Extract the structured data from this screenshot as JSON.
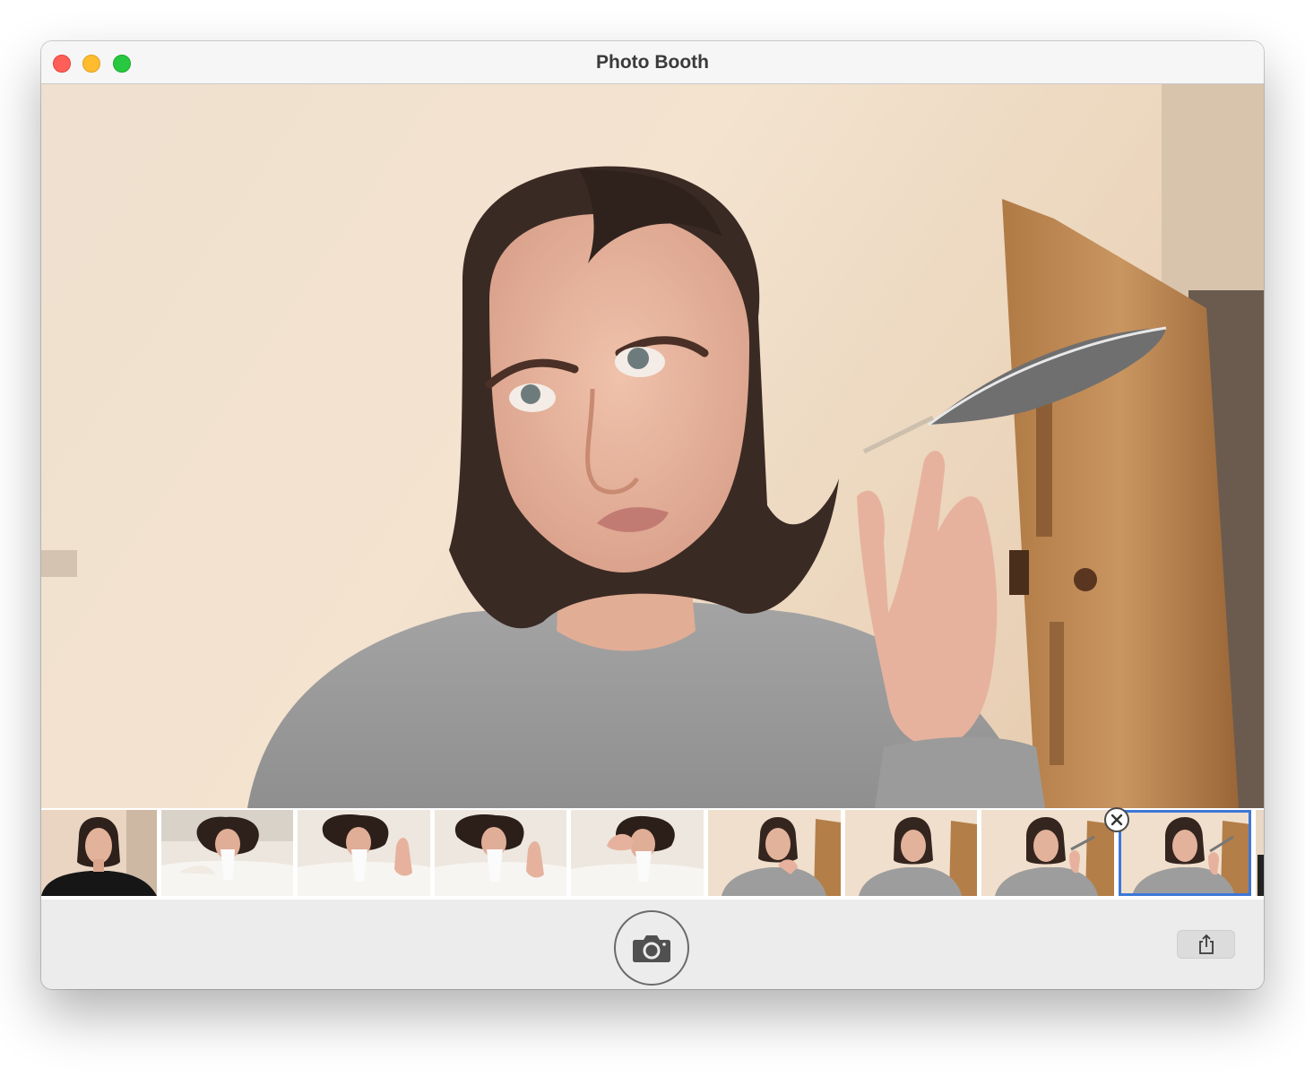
{
  "window": {
    "title": "Photo Booth"
  },
  "icons": {
    "close_light": "close-window-icon",
    "minimize_light": "minimize-window-icon",
    "zoom_light": "zoom-window-icon",
    "shutter": "camera-icon",
    "share": "share-icon",
    "delete": "close-x-icon"
  },
  "colors": {
    "close": "#ff5f57",
    "minimize": "#febc2e",
    "zoom": "#28c840",
    "selection": "#3d78d8"
  },
  "thumbnails": [
    {
      "scene": "portrait-dark-top",
      "selected": false
    },
    {
      "scene": "bed-tissue",
      "selected": false
    },
    {
      "scene": "bed-tissue-ok-hand",
      "selected": false
    },
    {
      "scene": "bed-tissue-ok-hand",
      "selected": false
    },
    {
      "scene": "bed-hand-on-face",
      "selected": false
    },
    {
      "scene": "grey-sweater-chin-on-hand",
      "selected": false
    },
    {
      "scene": "grey-sweater",
      "selected": false
    },
    {
      "scene": "grey-sweater-feather",
      "selected": false
    },
    {
      "scene": "grey-sweater-feather",
      "selected": true
    }
  ]
}
